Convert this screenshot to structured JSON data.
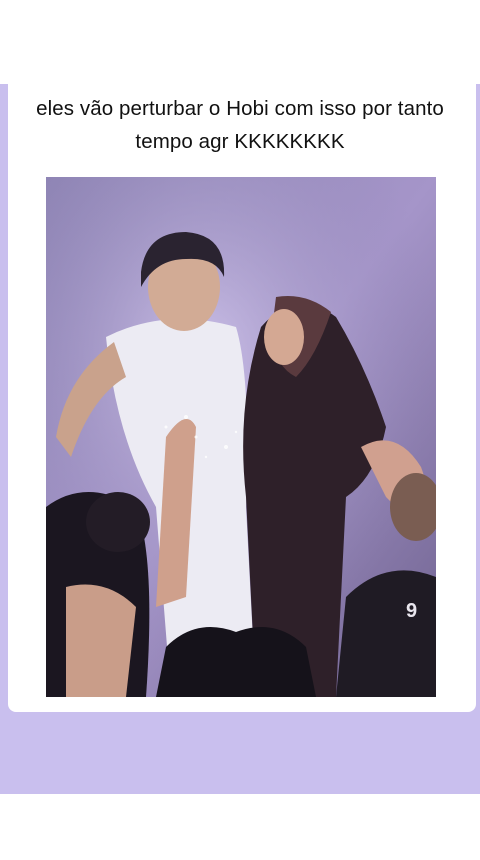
{
  "post": {
    "caption": "eles vão perturbar o Hobi com isso por tanto tempo agr KKKKKKKK"
  },
  "colors": {
    "background": "#c9bfee",
    "card": "#ffffff",
    "text": "#111111"
  }
}
